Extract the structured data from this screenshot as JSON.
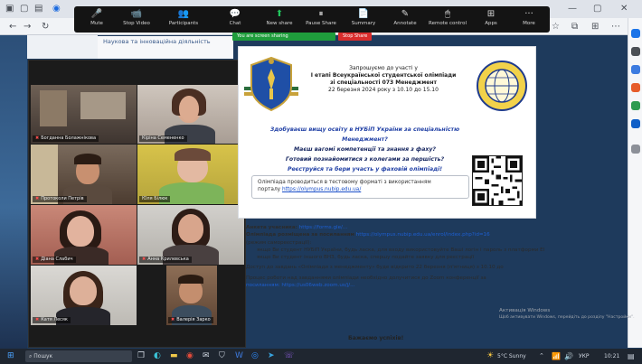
{
  "browser": {
    "back_icon": "back-arrow-icon",
    "forward_icon": "forward-arrow-icon",
    "reload_icon": "reload-icon"
  },
  "zoom_toolbar": {
    "buttons": [
      {
        "label": "Mute",
        "icon": "🎤"
      },
      {
        "label": "Stop Video",
        "icon": "📹"
      },
      {
        "label": "Participants",
        "icon": "👥"
      },
      {
        "label": "Chat",
        "icon": "💬"
      },
      {
        "label": "New share",
        "icon": "⬆"
      },
      {
        "label": "Pause Share",
        "icon": "⏸"
      },
      {
        "label": "Summary",
        "icon": "📄"
      },
      {
        "label": "Annotate",
        "icon": "✎"
      },
      {
        "label": "Remote control",
        "icon": "🖱"
      },
      {
        "label": "Apps",
        "icon": "⊞"
      },
      {
        "label": "More",
        "icon": "···"
      }
    ],
    "sharing_label": "You are screen sharing",
    "stop_share_label": "Stop Share",
    "colors": {
      "live": "#1f9d3c",
      "stop": "#d92c2c"
    }
  },
  "page_heading": "Наукова та інноваційна діяльність",
  "participants": [
    {
      "name": "Богданна Болажнікова"
    },
    {
      "name": "Кіріна Семененко"
    },
    {
      "name": "Протоколи Петрів"
    },
    {
      "name": "Юля Білюк"
    },
    {
      "name": "Діана Слабич"
    },
    {
      "name": "Анна Крилевська"
    },
    {
      "name": "Катя Лесяк"
    },
    {
      "name": "Валерія Зарко"
    }
  ],
  "document": {
    "invite_line1": "Запрошуємо до участі у",
    "invite_line2": "І етапі Всеукраїнської студентської олімпіади",
    "invite_line3": "зі спеціальності 073 Менеджмент",
    "invite_date": "22 березня 2024 року з 10.10 до 15.10",
    "q1": "Здобуваєш вищу освіту в НУБіП України за спеціальністю Менеджмент?",
    "q2": "Маєш вагомі компетенції та знання з фаху?",
    "q3": "Готовий познайомитися з колегами за першість?",
    "q4": "Реєструйся та бери участь у фаховій олімпіаді!",
    "note": "Олімпіада проводиться в тестовому форматі з використанням",
    "note2_prefix": "порталу",
    "note_link": "https://olympus.nubip.edu.ua/"
  },
  "instructions": {
    "l1_label": "Анкета учасника:",
    "l1_link": "https://forms.gle/...",
    "l2_label": "Олімпіада розміщена за посиланням",
    "l2_link": "https://olympus.nubip.edu.ua/enrol/index.php?id=16",
    "l3": "(режим самореєстрації):",
    "l4": "якщо Ви студент НУБіП України, будь ласка, для входу використовуйте Ваші логін і пароль з платформи Elearn;",
    "l5": "якщо Ви студент іншого ВНЗ, будь ласка, спершу подайте заявку для реєстрації",
    "l6": "Доступ до завдань «Олімпіади з менеджменту» буде відкрито 22 березня (п'ятниця) з 10.10 до",
    "l7": "Процес роботи над завданнями олімпіади необхідно долучитися до Zoom конференції за",
    "l8_link": "посиланням: https://us06web.zoom.us/j/..."
  },
  "greeting": "Бажаємо успіхів!",
  "activate_windows": {
    "line1": "Активація Windows",
    "line2": "Щоб активувати Windows, перейдіть до розділу \"Настройки\"."
  },
  "taskbar": {
    "search_placeholder": "Пошук",
    "weather": "5°C Sunny",
    "lang": "УКР",
    "time": "10:21"
  }
}
